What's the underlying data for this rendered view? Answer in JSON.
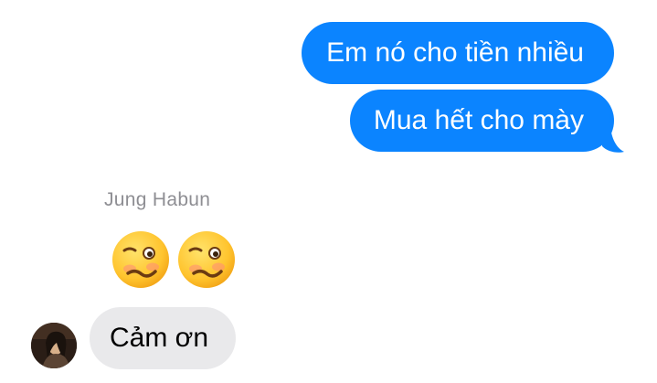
{
  "conversation": {
    "outgoing": [
      {
        "text": "Em nó cho tiền nhiều"
      },
      {
        "text": "Mua hết cho mày"
      }
    ],
    "incoming": {
      "sender_name": "Jung Habun",
      "emoji_icons": [
        "woozy-face-icon",
        "woozy-face-icon"
      ],
      "message": "Cảm ơn",
      "avatar": "avatar-photo"
    }
  },
  "colors": {
    "outgoing_bubble": "#0b84ff",
    "incoming_bubble": "#e9e9eb",
    "sender_name": "#8e8e93",
    "emoji_face": "#ffcc33"
  }
}
